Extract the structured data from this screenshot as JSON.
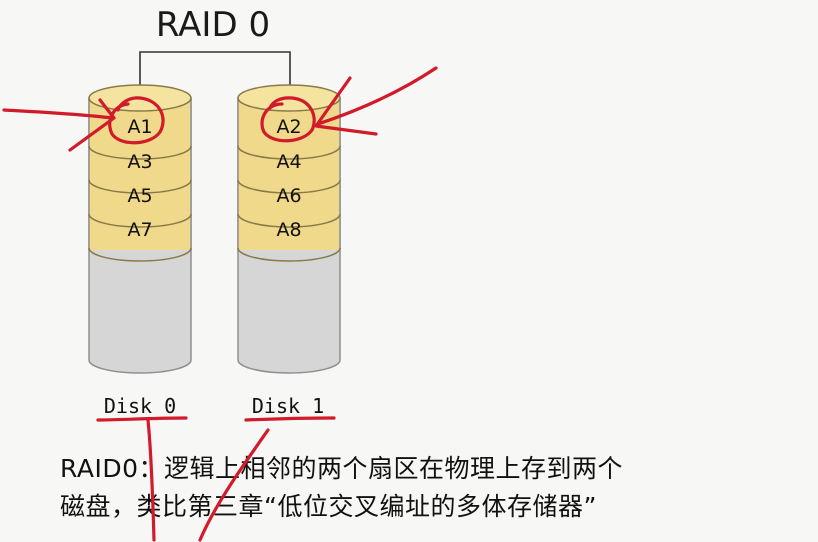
{
  "diagram": {
    "title": "RAID 0",
    "disks": [
      {
        "label": "Disk 0",
        "blocks": [
          "A1",
          "A3",
          "A5",
          "A7"
        ]
      },
      {
        "label": "Disk 1",
        "blocks": [
          "A2",
          "A4",
          "A6",
          "A8"
        ]
      }
    ]
  },
  "caption": {
    "line1": "RAID0：逻辑上相邻的两个扇区在物理上存到两个",
    "line2": "磁盘，类比第三章“低位交叉编址的多体存储器”"
  },
  "colors": {
    "block_fill": "#f0d98a",
    "block_stroke": "#8a7a4a",
    "disk_body": "#d6d6d6",
    "ink_red": "#d11a2a"
  }
}
